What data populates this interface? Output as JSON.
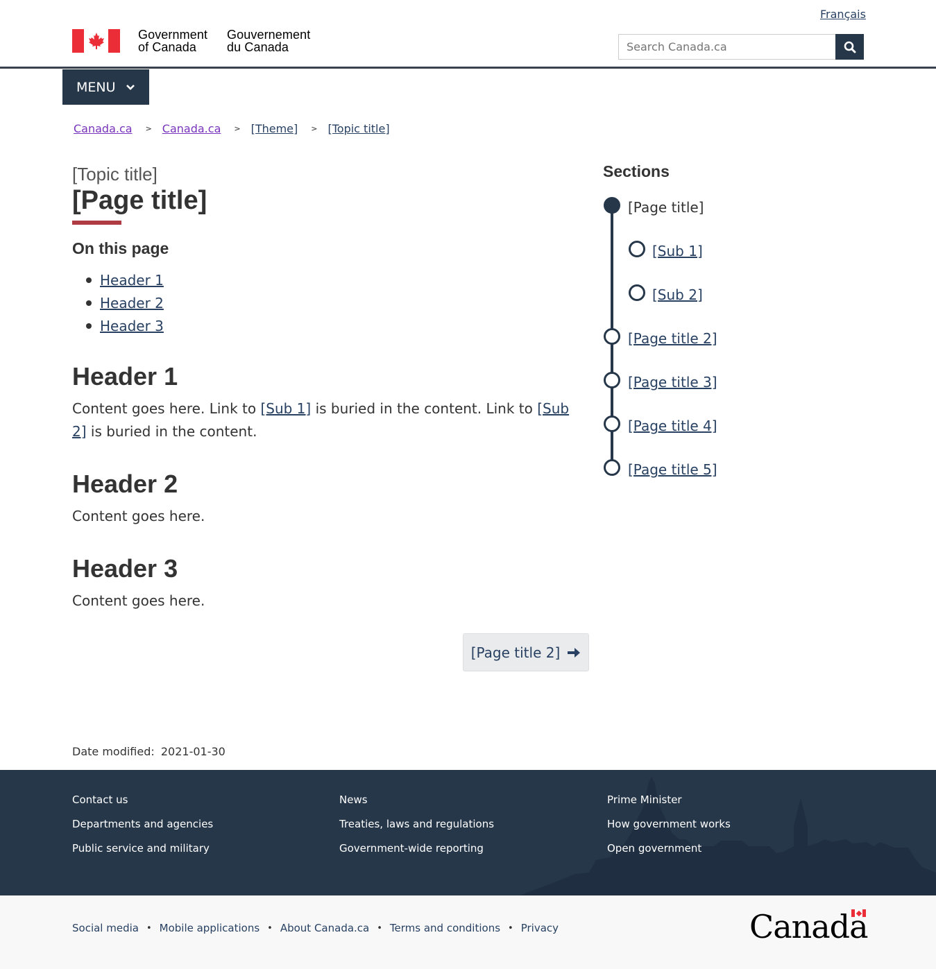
{
  "header": {
    "language_toggle": "Français",
    "wordmark_en_line1": "Government",
    "wordmark_en_line2": "of Canada",
    "wordmark_fr_line1": "Gouvernement",
    "wordmark_fr_line2": "du Canada",
    "search_placeholder": "Search Canada.ca",
    "menu_label": "MENU"
  },
  "breadcrumb": [
    {
      "label": "Canada.ca",
      "visited": true
    },
    {
      "label": "Canada.ca",
      "visited": true
    },
    {
      "label": "[Theme]",
      "visited": false
    },
    {
      "label": "[Topic title]",
      "visited": false
    }
  ],
  "breadcrumb_separator": ">",
  "main": {
    "topic_title": "[Topic title]",
    "page_title": "[Page title]",
    "on_this_page": "On this page",
    "toc": [
      "Header 1",
      "Header 2",
      "Header 3"
    ],
    "sections": [
      {
        "heading": "Header 1",
        "text_1": "Content goes here. Link to ",
        "link_1": "[Sub 1]",
        "text_2": " is buried in the content. Link to ",
        "link_2": "[Sub 2]",
        "text_3": " is buried in the content."
      },
      {
        "heading": "Header 2",
        "text_1": "Content goes here."
      },
      {
        "heading": "Header 3",
        "text_1": "Content goes here."
      }
    ],
    "next_button": "[Page title 2]",
    "date_modified_label": "Date modified:",
    "date_modified_value": "2021-01-30"
  },
  "sidebar": {
    "title": "Sections",
    "steps": [
      {
        "label": "[Page title]",
        "current": true
      },
      {
        "label": "[Sub 1]",
        "current": false
      },
      {
        "label": "[Sub 2]",
        "current": false
      },
      {
        "label": "[Page title 2]",
        "current": false
      },
      {
        "label": "[Page title 3]",
        "current": false
      },
      {
        "label": "[Page title 4]",
        "current": false
      },
      {
        "label": "[Page title 5]",
        "current": false
      }
    ]
  },
  "footer": {
    "col1": [
      "Contact us",
      "Departments and agencies",
      "Public service and military"
    ],
    "col2": [
      "News",
      "Treaties, laws and regulations",
      "Government-wide reporting"
    ],
    "col3": [
      "Prime Minister",
      "How government works",
      "Open government"
    ],
    "sub_links": [
      "Social media",
      "Mobile applications",
      "About Canada.ca",
      "Terms and conditions",
      "Privacy"
    ],
    "bullet": "•",
    "canada_wordmark": "Canada"
  },
  "colors": {
    "brand_dark": "#26374a",
    "link": "#284162",
    "visited": "#7834bc",
    "accent_red": "#af3c43",
    "flag_red": "#eb2d37"
  }
}
